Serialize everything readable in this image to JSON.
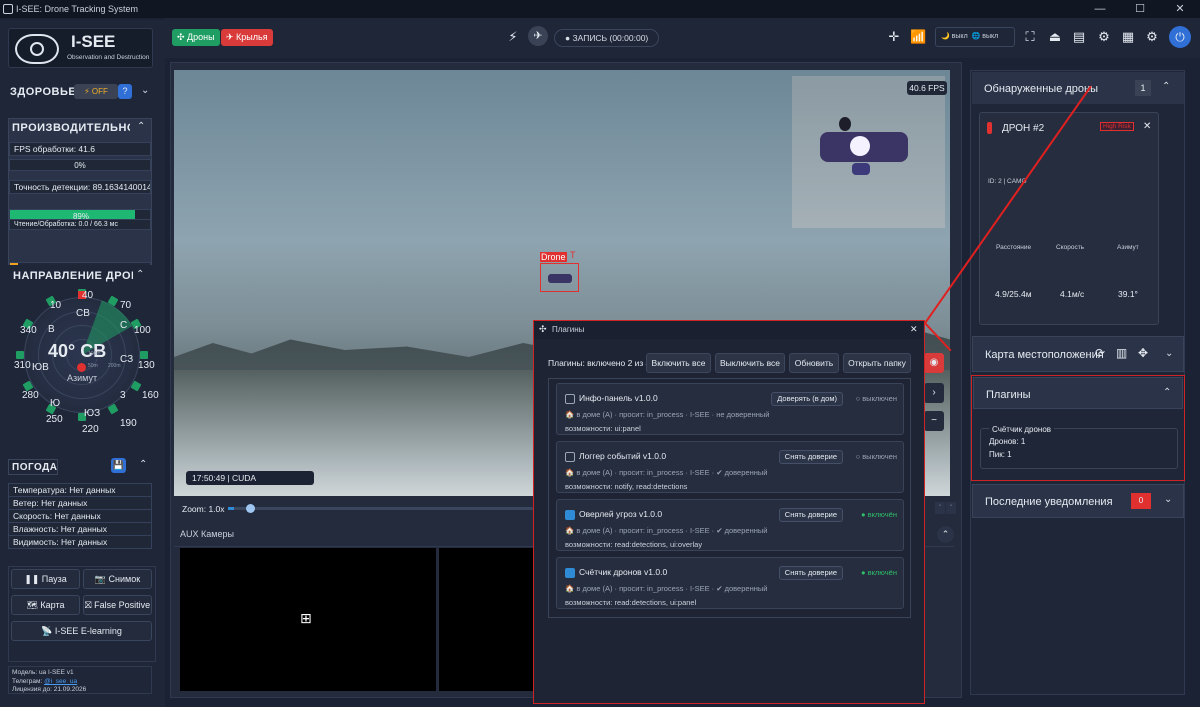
{
  "window": {
    "title": "I-SEE: Drone Tracking System",
    "controls": [
      "—",
      "☐",
      "✕"
    ]
  },
  "logo": {
    "name": "I-SEE",
    "subtitle": "Observation and Destruction"
  },
  "health": {
    "label": "ЗДОРОВЬЕ I",
    "toggle": "⚡ OFF",
    "help": "?"
  },
  "performance": {
    "title": "ПРОИЗВОДИТЕЛЬНОСТ",
    "fps_label": "FPS обработки: 41.6",
    "fps_pct": "0%",
    "fps_fill": 0,
    "acc_label": "Точность детекции: 89.16341400146484",
    "acc_pct": "89%",
    "acc_fill": 0.89,
    "io_label": "Чтение/Обработка: 0.0 / 66.3 мс",
    "io_pct": "6%",
    "io_fill": 0.06
  },
  "direction": {
    "title": "НАПРАВЛЕНИЕ ДРОНА",
    "heading": "40° СВ",
    "azimuth_label": "Азимут",
    "dist_labels": [
      "50m",
      "100m",
      "200m"
    ],
    "labels": [
      "СВ",
      "40",
      "10",
      "70",
      "340",
      "В",
      "С",
      "100",
      "310",
      "ЮВ",
      "СЗ",
      "130",
      "280",
      "3",
      "160",
      "Ю",
      "250",
      "ЮЗ",
      "190",
      "220"
    ]
  },
  "weather": {
    "title": "ПОГОДА",
    "rows": [
      "Температура: Нет данных",
      "Ветер: Нет данных",
      "Скорость: Нет данных",
      "Влажность: Нет данных",
      "Видимость: Нет данных"
    ]
  },
  "actions": {
    "pause": "Пауза",
    "snapshot": "Снимок",
    "map": "Карта",
    "false_positive": "False Positive",
    "elearning": "I-SEE E-learning"
  },
  "footer": {
    "model": "Модель: ua I-SEE v1",
    "telegram_label": "Телеграм:",
    "telegram": "@i_see_ua",
    "license": "Лицензия до: 21.09.2026"
  },
  "toolbar": {
    "drones": "Дроны",
    "wings": "Крылья",
    "record": "● ЗАПИСЬ (00:00:00)",
    "toggle1": "выкл",
    "toggle2": "выкл",
    "drones_color": "#1f9d63",
    "wings_color": "#d93a3a"
  },
  "video": {
    "fps": "40.6 FPS",
    "time": "17:50:49 | CUDA",
    "zoom": "Zoom: 1.0x",
    "zoom_level": 0.02,
    "bbox_label": "Drone",
    "overlay_text": "T",
    "aux": "AUX Камеры"
  },
  "detected": {
    "title": "Обнаруженные дроны",
    "count": "1",
    "drone": {
      "name": "ДРОН #2",
      "risk": "High Risk",
      "id": "ID: 2 | CAMO",
      "cols": [
        "Расстояние",
        "Скорость",
        "Азимут"
      ],
      "vals": [
        "4.9/25.4м",
        "4.1м/с",
        "39.1°"
      ]
    }
  },
  "location": {
    "title": "Карта местоположения"
  },
  "plugins_panel": {
    "title": "Плагины",
    "widget_title": "Счётчик дронов",
    "drones": "Дронов: 1",
    "peak": "Пик: 1"
  },
  "notifications": {
    "title": "Последние уведомления",
    "count": "0"
  },
  "dialog": {
    "title": "Плагины",
    "status": "Плагины: включено 2 из 4",
    "buttons": [
      "Включить все",
      "Выключить все",
      "Обновить",
      "Открыть папку"
    ],
    "plugins": [
      {
        "name": "Инфо-панель  v1.0.0",
        "meta": "🏠 в доме (A) · просит: in_process · I-SEE · не доверенный",
        "caps": "возможности: ui:panel",
        "action": "Доверять (в дом)",
        "state": "○ выключен",
        "on": false
      },
      {
        "name": "Логгер событий  v1.0.0",
        "meta": "🏠 в доме (A) · просит: in_process · I-SEE · ✔ доверенный",
        "caps": "возможности: notify, read:detections",
        "action": "Снять доверие",
        "state": "○ выключен",
        "on": false
      },
      {
        "name": "Оверлей угроз  v1.0.0",
        "meta": "🏠 в доме (A) · просит: in_process · I-SEE · ✔ доверенный",
        "caps": "возможности: read:detections, ui:overlay",
        "action": "Снять доверие",
        "state": "● включён",
        "on": true
      },
      {
        "name": "Счётчик дронов  v1.0.0",
        "meta": "🏠 в доме (A) · просит: in_process · I-SEE · ✔ доверенный",
        "caps": "возможности: read:detections, ui:panel",
        "action": "Снять доверие",
        "state": "● включён",
        "on": true
      }
    ]
  }
}
